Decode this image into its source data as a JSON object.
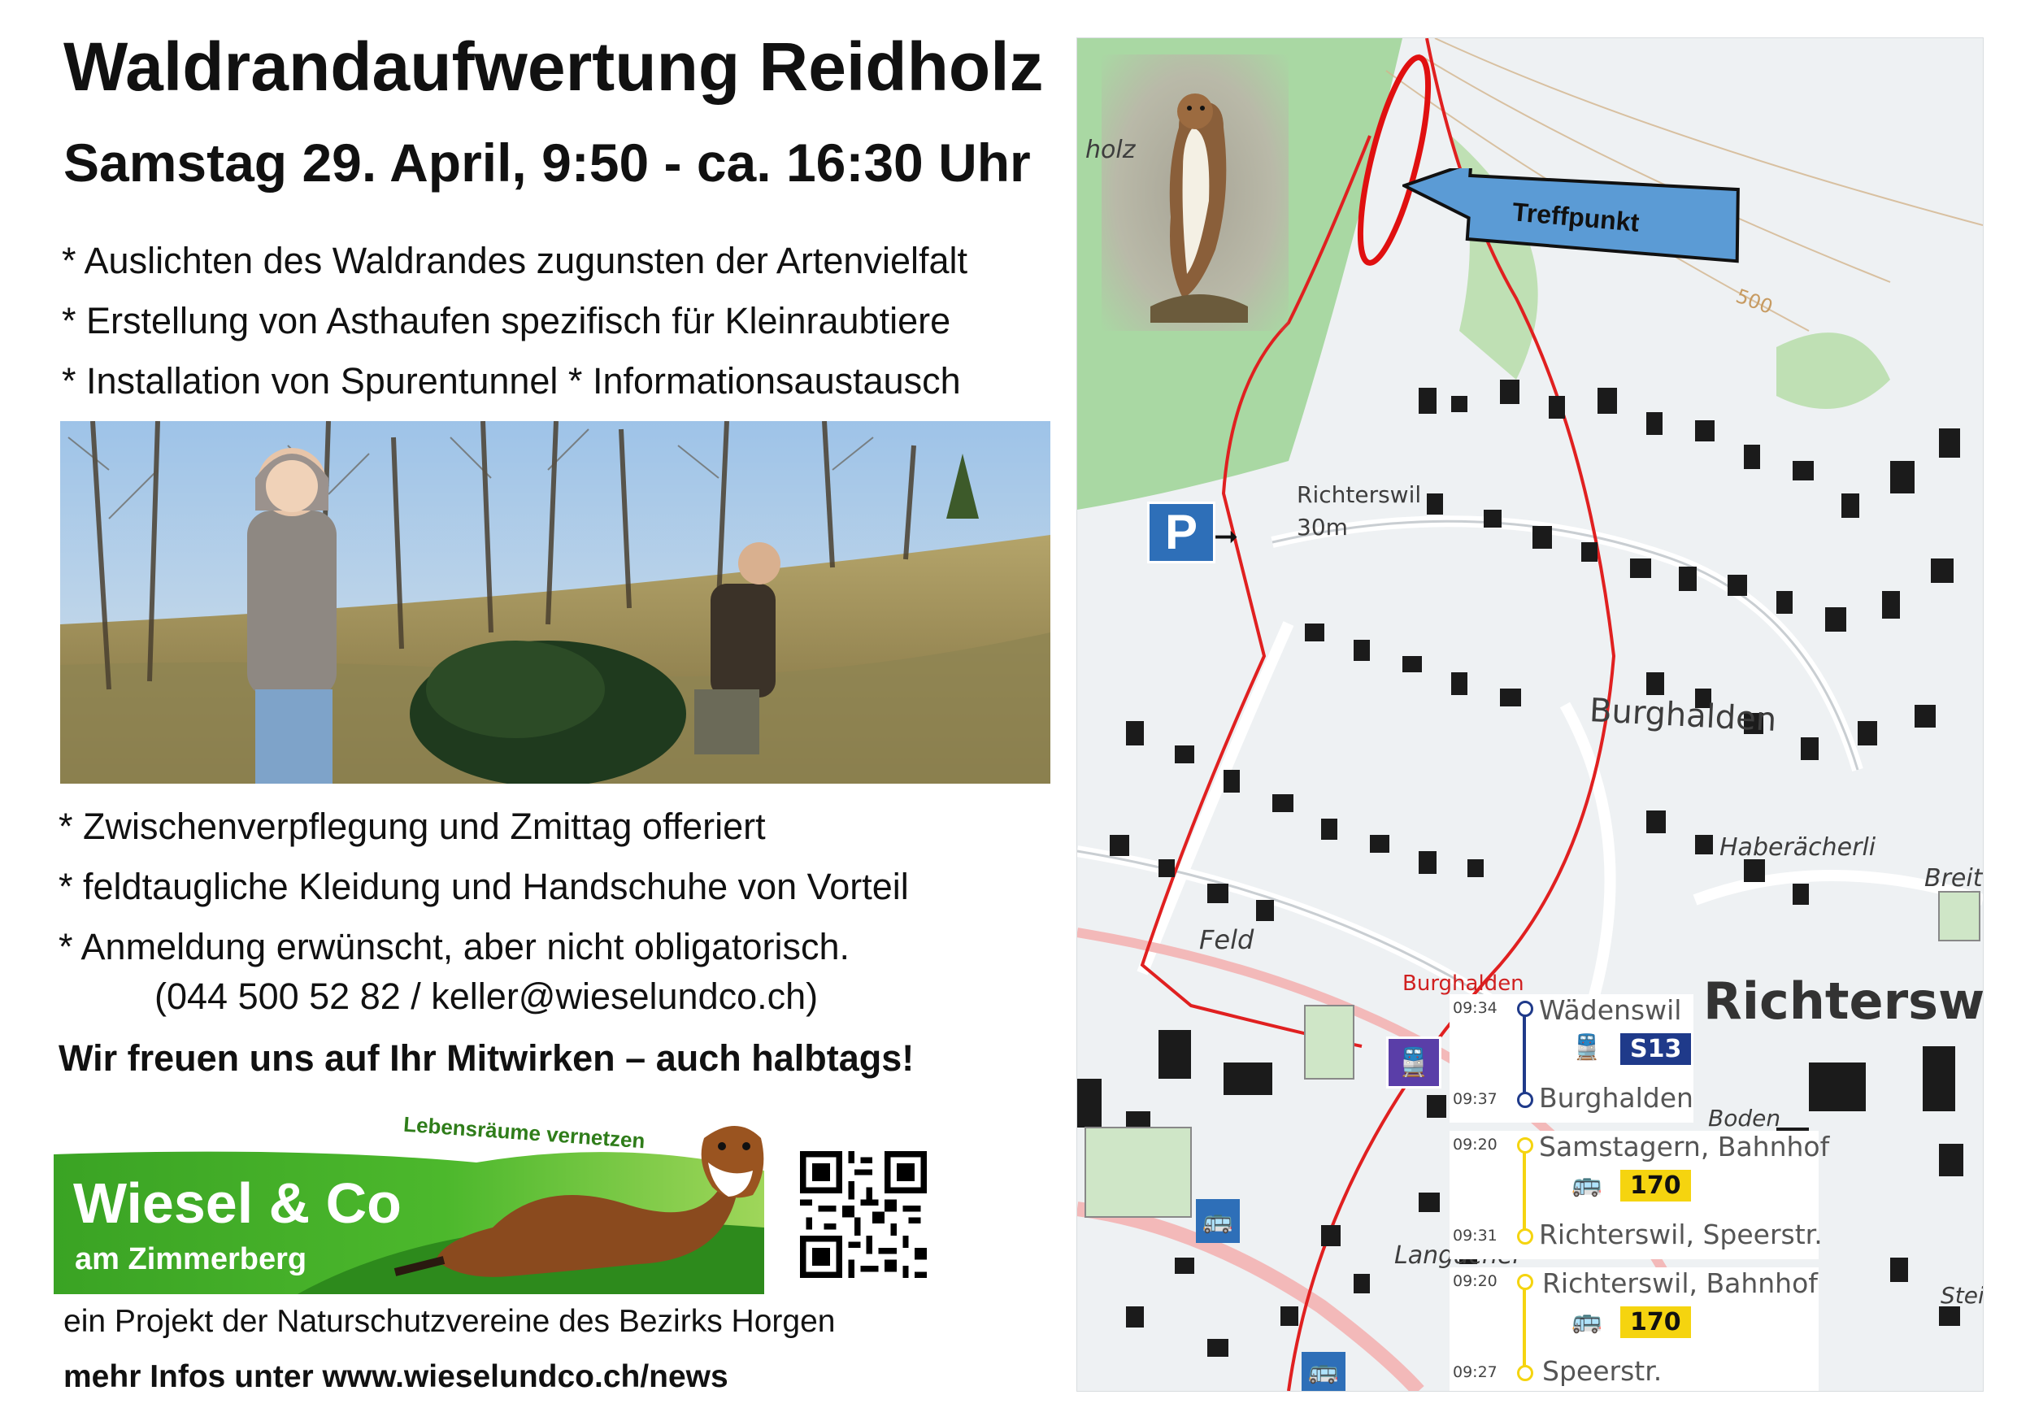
{
  "title": "Waldrandaufwertung Reidholz",
  "subtitle": "Samstag 29. April, 9:50 - ca. 16:30 Uhr",
  "bullets_top": [
    "* Auslichten des Waldrandes zugunsten der Artenvielfalt",
    "* Erstellung von Asthaufen spezifisch für Kleinraubtiere",
    "* Installation von Spurentunnel   * Informationsaustausch"
  ],
  "bullets_bottom": [
    "* Zwischenverpflegung und Zmittag offeriert",
    "* feldtaugliche Kleidung und Handschuhe von Vorteil",
    "* Anmeldung erwünscht, aber nicht obligatorisch."
  ],
  "contact": "(044 500 52 82 / keller@wieselundco.ch)",
  "thanks": "Wir freuen uns auf Ihr Mitwirken – auch halbtags!",
  "logo": {
    "tagline": "Lebensräume vernetzen",
    "name": "Wiesel & Co",
    "subname": "am Zimmerberg",
    "colors": {
      "green_dark": "#3a9a22",
      "green_light": "#8bd14a",
      "tagline_green": "#2f7d1a"
    }
  },
  "project_text": "ein Projekt der Naturschutzvereine des Bezirks Horgen",
  "more_info": "mehr Infos unter www.wieselundco.ch/news",
  "map": {
    "meeting_label": "Treffpunkt",
    "parking_symbol": "P",
    "labels": {
      "holz": "holz",
      "richterswil_elev": "Richterswil",
      "elev": "30m",
      "contour": "500",
      "burghalden": "Burghalden",
      "haberaecherli": "Haberächerli",
      "breite": "Breite",
      "feld": "Feld",
      "burghalden_station": "Burghalden",
      "richterswil_big": "Richterswil",
      "boden": "Boden",
      "langacher": "Langacher",
      "steing": "Steing"
    },
    "colors": {
      "route_red": "#e02020",
      "forest": "#a9d8a3",
      "arrow_blue": "#5b9bd5",
      "train_blue": "#1f3a8a",
      "bus_yellow": "#f5d40f",
      "station_purple": "#5a3ea8",
      "bus_icon_blue": "#2e6fb8"
    },
    "connections": [
      {
        "dep_time": "09:34",
        "from": "Wädenswil",
        "line": "S13",
        "mode": "train",
        "arr_time": "09:37",
        "to": "Burghalden"
      },
      {
        "dep_time": "09:20",
        "from": "Samstagern, Bahnhof",
        "line": "170",
        "mode": "bus",
        "arr_time": "09:31",
        "to": "Richterswil, Speerstr."
      },
      {
        "dep_time": "09:20",
        "from": "Richterswil, Bahnhof",
        "line": "170",
        "mode": "bus",
        "arr_time": "09:27",
        "to": "Speerstr."
      }
    ]
  }
}
